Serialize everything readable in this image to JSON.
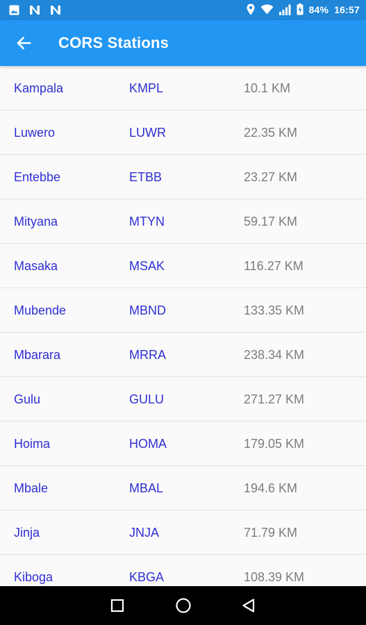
{
  "status_bar": {
    "battery": "84%",
    "time": "16:57",
    "icons": [
      "image-icon",
      "n-notification-icon",
      "n-notification-icon",
      "location-icon",
      "wifi-icon",
      "signal-icon",
      "battery-icon"
    ]
  },
  "app_bar": {
    "title": "CORS Stations",
    "back_icon": "arrow-left-icon"
  },
  "stations": [
    {
      "name": "Kampala",
      "code": "KMPL",
      "distance": "10.1 KM"
    },
    {
      "name": "Luwero",
      "code": "LUWR",
      "distance": "22.35 KM"
    },
    {
      "name": "Entebbe",
      "code": "ETBB",
      "distance": "23.27 KM"
    },
    {
      "name": "Mityana",
      "code": "MTYN",
      "distance": "59.17 KM"
    },
    {
      "name": "Masaka",
      "code": "MSAK",
      "distance": "116.27 KM"
    },
    {
      "name": "Mubende",
      "code": "MBND",
      "distance": "133.35 KM"
    },
    {
      "name": "Mbarara",
      "code": "MRRA",
      "distance": "238.34 KM"
    },
    {
      "name": "Gulu",
      "code": "GULU",
      "distance": "271.27 KM"
    },
    {
      "name": "Hoima",
      "code": "HOMA",
      "distance": "179.05 KM"
    },
    {
      "name": "Mbale",
      "code": "MBAL",
      "distance": "194.6 KM"
    },
    {
      "name": "Jinja",
      "code": "JNJA",
      "distance": "71.79 KM"
    },
    {
      "name": "Kiboga",
      "code": "KBGA",
      "distance": "108.39 KM"
    }
  ],
  "nav_bar": {
    "icons": [
      "recents-square-icon",
      "home-circle-icon",
      "back-triangle-icon"
    ]
  },
  "colors": {
    "status_bar": "#1f86d8",
    "app_bar": "#2196f3",
    "link_text": "#2f2fd4",
    "distance_text": "#7c7c7c",
    "background": "#fafafa",
    "nav_bar": "#000000"
  }
}
